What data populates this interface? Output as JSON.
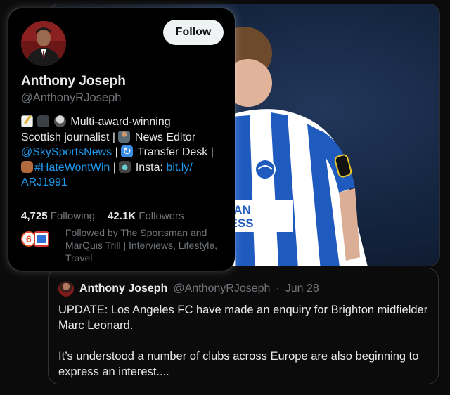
{
  "profile": {
    "name": "Anthony Joseph",
    "handle": "@AnthonyRJoseph",
    "follow_label": "Follow",
    "bio": {
      "t1": "Multi-award-winning",
      "t2": "Scottish journalist |",
      "t3": "News Editor",
      "link_sky": "@SkySportsNews",
      "t4": "|",
      "t5": "Transfer Desk |",
      "link_hashtag": "#HateWontWin",
      "t6": "|",
      "t7": "Insta:",
      "link_insta_1": "bit.ly/",
      "link_insta_2": "ARJ1991"
    },
    "stats": {
      "following_count": "4,725",
      "following_label": "Following",
      "followers_count": "42.1K",
      "followers_label": "Followers"
    },
    "followed_by": "Followed by The Sportsman and MarQuis Trill | Interviews, Lifestyle, Travel"
  },
  "quote": {
    "name": "Anthony Joseph",
    "handle": "@AnthonyRJoseph",
    "sep": "·",
    "date": "Jun 28",
    "para1": "UPDATE: Los Angeles FC have made an enquiry for Brighton midfielder Marc Leonard.",
    "para2": "It’s understood a number of clubs across Europe are also beginning to express an interest...."
  },
  "media": {
    "shirt_sponsor_1": "RICAN",
    "shirt_sponsor_2": "PRESS"
  },
  "colors": {
    "link": "#1d9bf0",
    "muted": "#71767b",
    "text": "#e7e9ea",
    "jersey_blue": "#1f5bbf"
  }
}
